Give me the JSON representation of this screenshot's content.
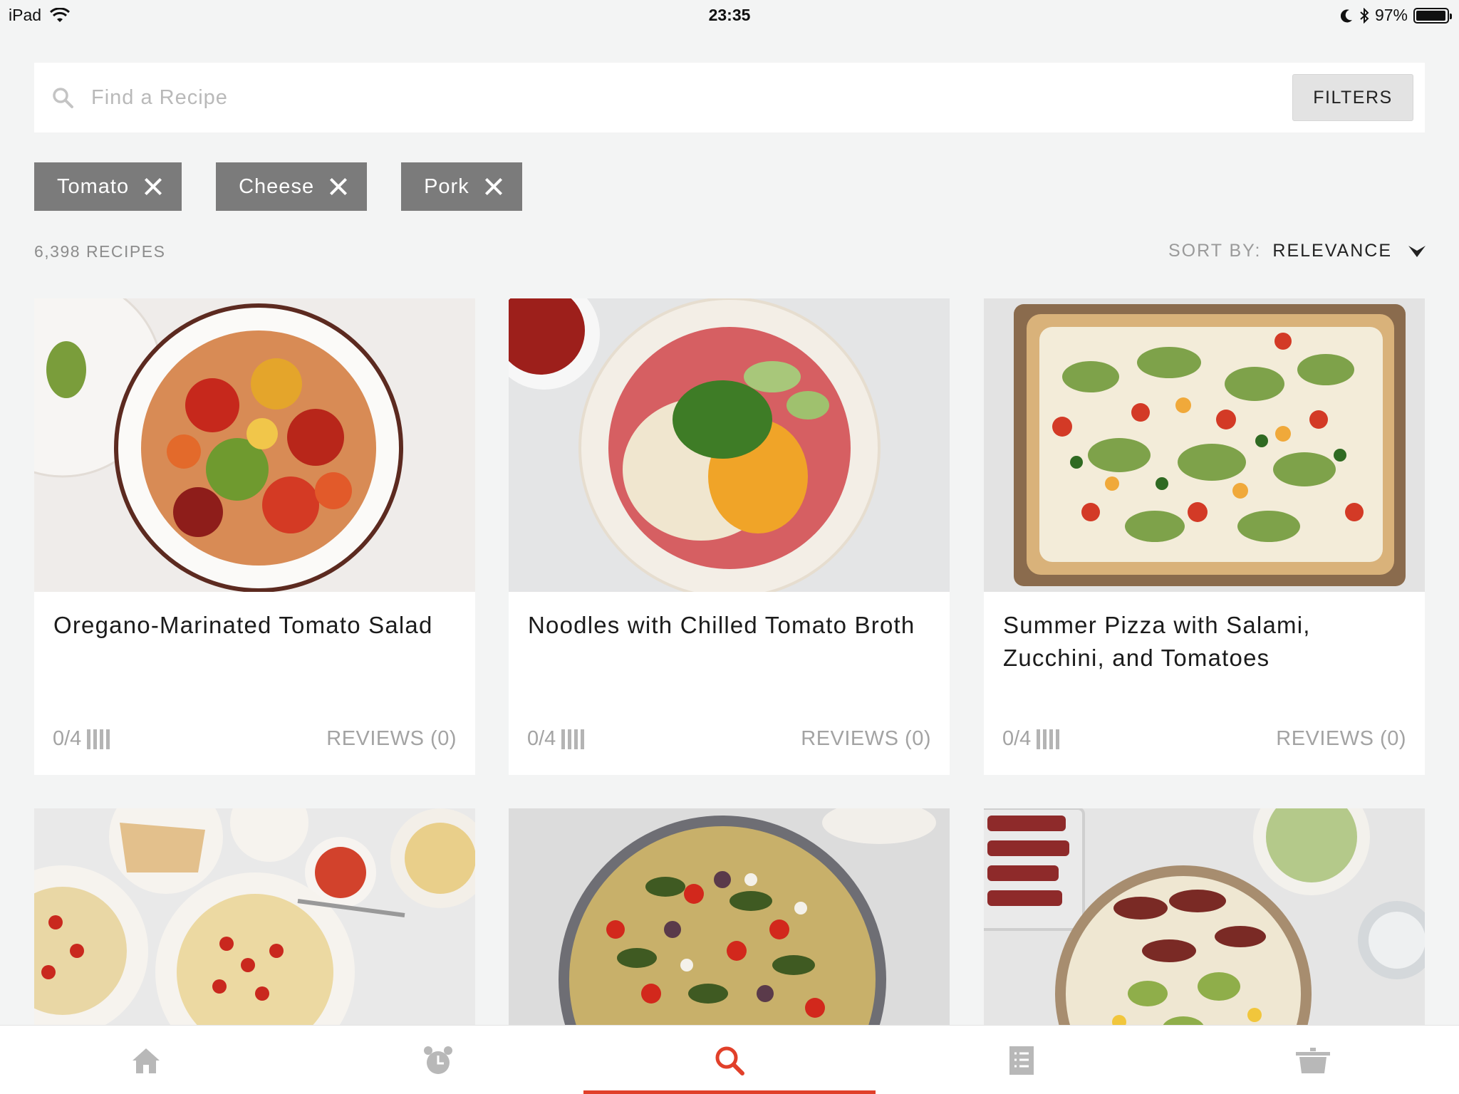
{
  "status_bar": {
    "device": "iPad",
    "time": "23:35",
    "battery_percent": "97%",
    "battery_level": 0.97
  },
  "search": {
    "placeholder": "Find a Recipe",
    "value": "",
    "filters_label": "FILTERS"
  },
  "chips": [
    {
      "label": "Tomato"
    },
    {
      "label": "Cheese"
    },
    {
      "label": "Pork"
    }
  ],
  "results": {
    "count_label": "6,398 RECIPES",
    "sort_label": "SORT BY:",
    "sort_value": "RELEVANCE"
  },
  "recipes": [
    {
      "title": "Oregano-Marinated Tomato Salad",
      "rating": "0/4",
      "reviews": "REVIEWS (0)"
    },
    {
      "title": "Noodles with Chilled Tomato Broth",
      "rating": "0/4",
      "reviews": "REVIEWS (0)"
    },
    {
      "title": "Summer Pizza with Salami, Zucchini, and Tomatoes",
      "rating": "0/4",
      "reviews": "REVIEWS (0)"
    },
    {
      "title": "",
      "rating": "",
      "reviews": ""
    },
    {
      "title": "",
      "rating": "",
      "reviews": ""
    },
    {
      "title": "",
      "rating": "",
      "reviews": ""
    }
  ],
  "tabs": [
    {
      "icon": "home-icon",
      "active": false
    },
    {
      "icon": "alarm-clock-icon",
      "active": false
    },
    {
      "icon": "search-icon",
      "active": true
    },
    {
      "icon": "shopping-list-icon",
      "active": false
    },
    {
      "icon": "pot-icon",
      "active": false
    }
  ],
  "colors": {
    "accent": "#e1402a",
    "chip_bg": "#7b7b7b",
    "background": "#f3f4f4",
    "tab_inactive": "#b8b8b8"
  }
}
